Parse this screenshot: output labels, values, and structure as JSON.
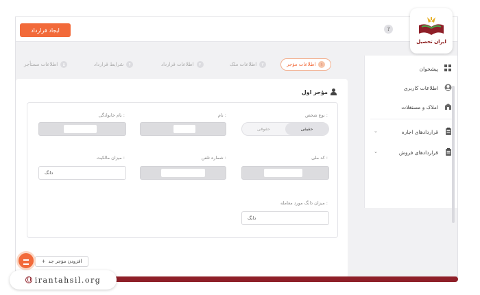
{
  "header": {
    "create_contract_label": "ایجاد قرارداد",
    "help_label": "?"
  },
  "sidebar": {
    "items": [
      {
        "label": "پیشخوان",
        "icon": "dashboard-icon"
      },
      {
        "label": "اطلاعات کاربری",
        "icon": "user-icon"
      },
      {
        "label": "املاک و مستغلات",
        "icon": "building-icon"
      },
      {
        "label": "قراردادهای اجاره",
        "icon": "clipboard-icon"
      },
      {
        "label": "قراردادهای فروش",
        "icon": "clipboard-icon"
      }
    ]
  },
  "stepper": {
    "steps": [
      {
        "num": "۱",
        "label": "اطلاعات مؤجر",
        "active": true
      },
      {
        "num": "۲",
        "label": "اطلاعات ملک"
      },
      {
        "num": "۳",
        "label": "اطلاعات قرارداد"
      },
      {
        "num": "۴",
        "label": "شرایط قرارداد"
      },
      {
        "num": "۵",
        "label": "اطلاعات مستأجر"
      }
    ]
  },
  "card": {
    "title": "مؤجر اول",
    "person_type_label": "نوع شخص :",
    "person_type_options": [
      "حقیقی",
      "حقوقی"
    ],
    "name_label": "نام :",
    "family_label": "نام خانوادگی :",
    "national_code_label": "کد ملی :",
    "phone_label": "شماره تلفن :",
    "ownership_label": "میزان مالکیت :",
    "ownership_value": "دانگ",
    "dang_label": "میزان دانگ مورد معامله :",
    "dang_value": "دانگ",
    "add_person_label": "افزودن مؤجر جد"
  },
  "watermark": {
    "logo_text": "ایران تحصیل",
    "site": "irantahsil.org"
  },
  "colors": {
    "accent": "#f26a3a",
    "brand_dark": "#8e1f28"
  }
}
